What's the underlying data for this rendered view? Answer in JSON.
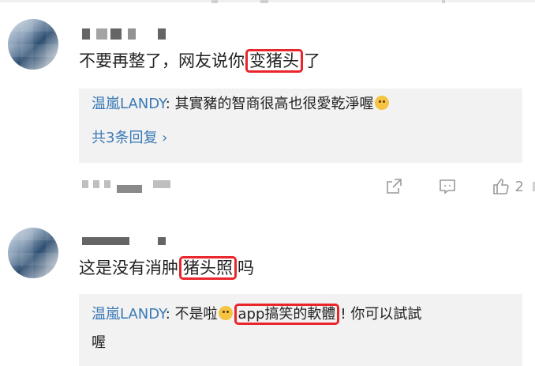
{
  "comments": [
    {
      "text_before": "不要再整了，网友说你",
      "highlight": "变猪头",
      "text_after": "了",
      "reply": {
        "user": "温嵐LANDY",
        "separator": ": ",
        "text": "其實豬的智商很高也很愛乾淨喔",
        "emoji": "grinning-sweat-emoji",
        "more": "共3条回复 ›"
      },
      "like_count": "2"
    },
    {
      "text_before": "这是没有消肿",
      "highlight": "猪头照",
      "text_after": "吗",
      "reply": {
        "user": "温嵐LANDY",
        "separator": ": ",
        "text_before": "不是啦",
        "emoji": "rofl-emoji",
        "highlight": "app搞笑的軟體",
        "text_after": "! 你可以試試",
        "text_line2": "喔"
      }
    }
  ],
  "colors": {
    "highlight_border": "#e8262c",
    "link": "#3b79b6",
    "reply_bg": "#f2f2f2",
    "icon_gray": "#9a9a9a"
  }
}
